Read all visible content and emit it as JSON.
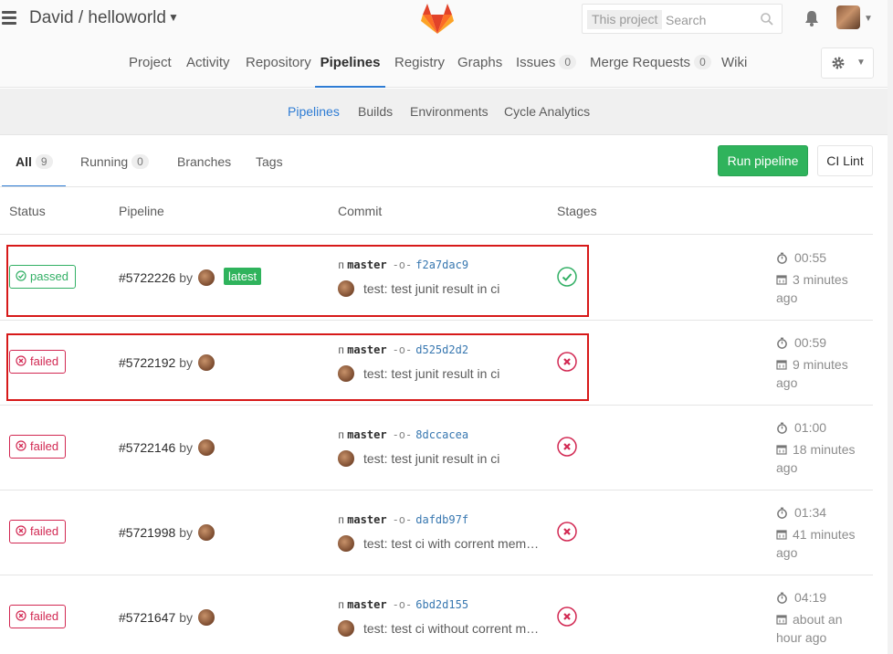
{
  "header": {
    "title": "David / helloworld",
    "search": {
      "scope": "This project",
      "placeholder": "Search"
    }
  },
  "nav": {
    "items": [
      {
        "label": "Project"
      },
      {
        "label": "Activity"
      },
      {
        "label": "Repository"
      },
      {
        "label": "Pipelines",
        "active": true
      },
      {
        "label": "Registry"
      },
      {
        "label": "Graphs"
      },
      {
        "label": "Issues",
        "badge": "0"
      },
      {
        "label": "Merge Requests",
        "badge": "0"
      },
      {
        "label": "Wiki"
      }
    ]
  },
  "subnav": {
    "items": [
      {
        "label": "Pipelines",
        "active": true
      },
      {
        "label": "Builds"
      },
      {
        "label": "Environments"
      },
      {
        "label": "Cycle Analytics"
      }
    ]
  },
  "tabs": {
    "all": {
      "label": "All",
      "count": "9"
    },
    "running": {
      "label": "Running",
      "count": "0"
    },
    "branches": {
      "label": "Branches"
    },
    "tags": {
      "label": "Tags"
    },
    "run_pipeline": "Run pipeline",
    "ci_lint": "CI Lint"
  },
  "table": {
    "headers": {
      "status": "Status",
      "pipeline": "Pipeline",
      "commit": "Commit",
      "stages": "Stages"
    },
    "rows": [
      {
        "status": "passed",
        "id": "#5722226",
        "by": "by",
        "latest": "latest",
        "branch": "master",
        "sha": "f2a7dac9",
        "message": "test: test junit result in ci",
        "duration": "00:55",
        "when": "3 minutes ago"
      },
      {
        "status": "failed",
        "id": "#5722192",
        "by": "by",
        "branch": "master",
        "sha": "d525d2d2",
        "message": "test: test junit result in ci",
        "duration": "00:59",
        "when": "9 minutes ago"
      },
      {
        "status": "failed",
        "id": "#5722146",
        "by": "by",
        "branch": "master",
        "sha": "8dccacea",
        "message": "test: test junit result in ci",
        "duration": "01:00",
        "when": "18 minutes ago"
      },
      {
        "status": "failed",
        "id": "#5721998",
        "by": "by",
        "branch": "master",
        "sha": "dafdb97f",
        "message": "test: test ci with corrent mem…",
        "duration": "01:34",
        "when": "41 minutes ago"
      },
      {
        "status": "failed",
        "id": "#5721647",
        "by": "by",
        "branch": "master",
        "sha": "6bd2d155",
        "message": "test: test ci without corrent m…",
        "duration": "04:19",
        "when": "about an hour ago"
      }
    ]
  },
  "colors": {
    "passed": "#31af64",
    "failed": "#d22852",
    "accent": "#2e7cd4",
    "run_button": "#2fb35c",
    "highlight": "#d71919"
  },
  "icons": {
    "menu": "hamburger-icon",
    "logo": "gitlab-tanuki-icon",
    "search": "search-icon",
    "notifications": "bell-icon",
    "settings": "gear-icon",
    "duration": "stopwatch-icon",
    "date": "calendar-icon",
    "branch": "branch-icon",
    "commit": "commit-icon"
  }
}
